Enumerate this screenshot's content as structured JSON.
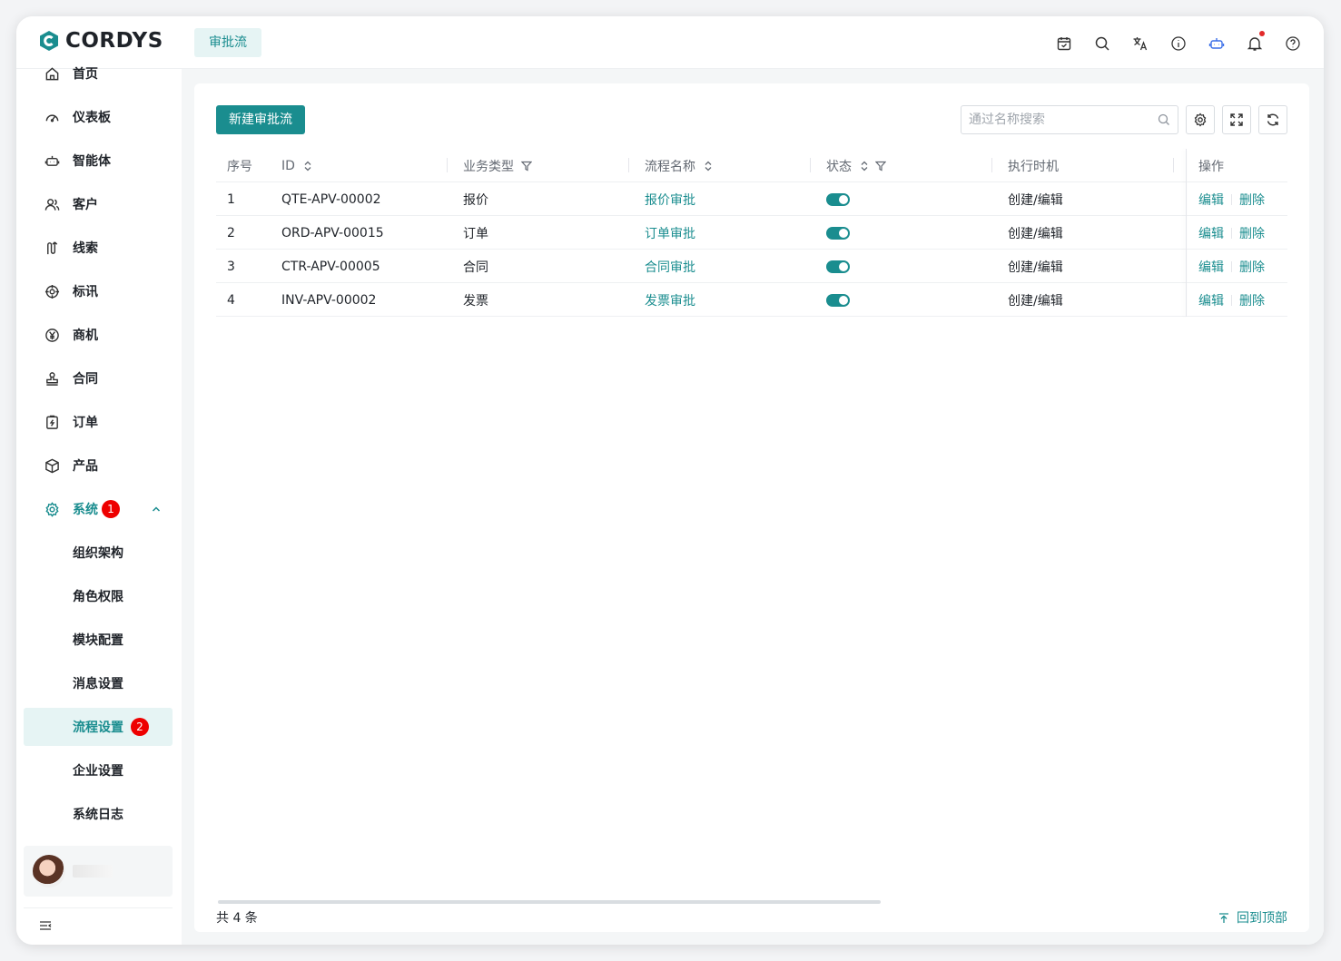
{
  "app": {
    "logo_text": "CORDYS",
    "brand_color": "#1a8d8f"
  },
  "header": {
    "active_tab": "审批流",
    "icons": [
      "calendar-icon",
      "search-icon",
      "translate-icon",
      "info-icon",
      "robot-icon",
      "bell-icon",
      "help-icon"
    ]
  },
  "sidebar": {
    "items": [
      {
        "label": "首页",
        "icon": "home-icon"
      },
      {
        "label": "仪表板",
        "icon": "dashboard-icon"
      },
      {
        "label": "智能体",
        "icon": "robot-icon"
      },
      {
        "label": "客户",
        "icon": "users-icon"
      },
      {
        "label": "线索",
        "icon": "lead-icon"
      },
      {
        "label": "标讯",
        "icon": "target-icon"
      },
      {
        "label": "商机",
        "icon": "yen-icon"
      },
      {
        "label": "合同",
        "icon": "stamp-icon"
      },
      {
        "label": "订单",
        "icon": "order-icon"
      },
      {
        "label": "产品",
        "icon": "cube-icon"
      },
      {
        "label": "系统",
        "icon": "gear-icon",
        "badge": "1"
      }
    ],
    "sub_items": [
      {
        "label": "组织架构"
      },
      {
        "label": "角色权限"
      },
      {
        "label": "模块配置"
      },
      {
        "label": "消息设置"
      },
      {
        "label": "流程设置",
        "badge": "2"
      },
      {
        "label": "企业设置"
      },
      {
        "label": "系统日志"
      }
    ]
  },
  "toolbar": {
    "new_button": "新建审批流",
    "search_placeholder": "通过名称搜索"
  },
  "table": {
    "columns": [
      "序号",
      "ID",
      "业务类型",
      "流程名称",
      "状态",
      "执行时机",
      "操作"
    ],
    "rows": [
      {
        "index": "1",
        "id": "QTE-APV-00002",
        "type": "报价",
        "name": "报价审批",
        "enabled": true,
        "timing": "创建/编辑",
        "edit": "编辑",
        "delete": "删除"
      },
      {
        "index": "2",
        "id": "ORD-APV-00015",
        "type": "订单",
        "name": "订单审批",
        "enabled": true,
        "timing": "创建/编辑",
        "edit": "编辑",
        "delete": "删除"
      },
      {
        "index": "3",
        "id": "CTR-APV-00005",
        "type": "合同",
        "name": "合同审批",
        "enabled": true,
        "timing": "创建/编辑",
        "edit": "编辑",
        "delete": "删除"
      },
      {
        "index": "4",
        "id": "INV-APV-00002",
        "type": "发票",
        "name": "发票审批",
        "enabled": true,
        "timing": "创建/编辑",
        "edit": "编辑",
        "delete": "删除"
      }
    ]
  },
  "footer": {
    "total": "共 4 条",
    "back_to_top": "回到顶部"
  }
}
